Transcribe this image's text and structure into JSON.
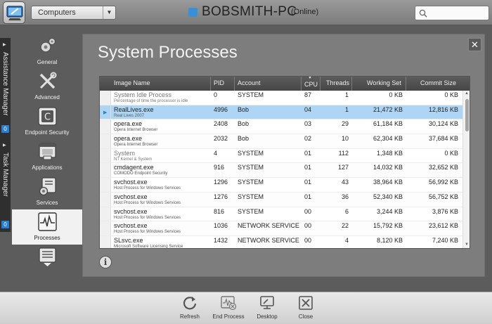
{
  "header": {
    "group_select": "Computers",
    "computer_name": "BOBSMITH-PC",
    "status": "(Online)",
    "search_placeholder": "",
    "status_color": "#3a8fd8"
  },
  "side_tabs": [
    {
      "label": "Assistance Manager",
      "badge": "0"
    },
    {
      "label": "Task Manager",
      "badge": "0"
    }
  ],
  "nav": {
    "items": [
      {
        "label": "General",
        "icon": "gears-icon"
      },
      {
        "label": "Advanced",
        "icon": "tools-icon"
      },
      {
        "label": "Endpoint Security",
        "icon": "comodo-c-icon"
      },
      {
        "label": "Applications",
        "icon": "applications-icon"
      },
      {
        "label": "Services",
        "icon": "services-icon"
      },
      {
        "label": "Processes",
        "icon": "processes-icon",
        "active": true
      }
    ]
  },
  "panel": {
    "title": "System Processes",
    "columns": [
      "Image Name",
      "PID",
      "Account",
      "CPU",
      "Threads",
      "Working Set",
      "Commit Size"
    ],
    "processes": [
      {
        "name": "System Idle Process",
        "desc": "Percentage of time the processor is idle",
        "pid": "0",
        "account": "SYSTEM",
        "cpu": "87",
        "threads": "1",
        "working_set": "0 KB",
        "commit_size": "0 KB",
        "dim": true
      },
      {
        "name": "RealLives.exe",
        "desc": "Real Lives 2007",
        "pid": "4996",
        "account": "Bob",
        "cpu": "04",
        "threads": "1",
        "working_set": "21,472 KB",
        "commit_size": "12,816 KB",
        "selected": true
      },
      {
        "name": "opera.exe",
        "desc": "Opera Internet Browser",
        "pid": "2408",
        "account": "Bob",
        "cpu": "03",
        "threads": "29",
        "working_set": "61,184 KB",
        "commit_size": "30,124 KB"
      },
      {
        "name": "opera.exe",
        "desc": "Opera Internet Browser",
        "pid": "2032",
        "account": "Bob",
        "cpu": "02",
        "threads": "10",
        "working_set": "62,304 KB",
        "commit_size": "37,684 KB"
      },
      {
        "name": "System",
        "desc": "NT Kernel & System",
        "pid": "4",
        "account": "SYSTEM",
        "cpu": "01",
        "threads": "112",
        "working_set": "1,348 KB",
        "commit_size": "0 KB",
        "dim": true
      },
      {
        "name": "cmdagent.exe",
        "desc": "COMODO Endpoint Security",
        "pid": "916",
        "account": "SYSTEM",
        "cpu": "01",
        "threads": "127",
        "working_set": "14,032 KB",
        "commit_size": "32,652 KB"
      },
      {
        "name": "svchost.exe",
        "desc": "Host Process for Windows Services",
        "pid": "1296",
        "account": "SYSTEM",
        "cpu": "01",
        "threads": "43",
        "working_set": "38,964 KB",
        "commit_size": "56,992 KB"
      },
      {
        "name": "svchost.exe",
        "desc": "Host Process for Windows Services",
        "pid": "1276",
        "account": "SYSTEM",
        "cpu": "01",
        "threads": "36",
        "working_set": "52,340 KB",
        "commit_size": "56,752 KB"
      },
      {
        "name": "svchost.exe",
        "desc": "Host Process for Windows Services",
        "pid": "816",
        "account": "SYSTEM",
        "cpu": "00",
        "threads": "6",
        "working_set": "3,244 KB",
        "commit_size": "3,876 KB"
      },
      {
        "name": "svchost.exe",
        "desc": "Host Process for Windows Services",
        "pid": "1036",
        "account": "NETWORK SERVICE",
        "cpu": "00",
        "threads": "22",
        "working_set": "15,792 KB",
        "commit_size": "23,612 KB"
      },
      {
        "name": "SLsvc.exe",
        "desc": "Microsoft Software Licensing Service",
        "pid": "1432",
        "account": "NETWORK SERVICE",
        "cpu": "00",
        "threads": "4",
        "working_set": "8,120 KB",
        "commit_size": "7,240 KB"
      }
    ]
  },
  "actions": [
    {
      "label": "Refresh",
      "icon": "refresh-icon"
    },
    {
      "label": "End Process",
      "icon": "end-process-icon"
    },
    {
      "label": "Desktop",
      "icon": "desktop-icon"
    },
    {
      "label": "Close",
      "icon": "close-icon"
    }
  ],
  "colors": {
    "accent": "#2a7fd4",
    "selection": "#aed6f4"
  }
}
